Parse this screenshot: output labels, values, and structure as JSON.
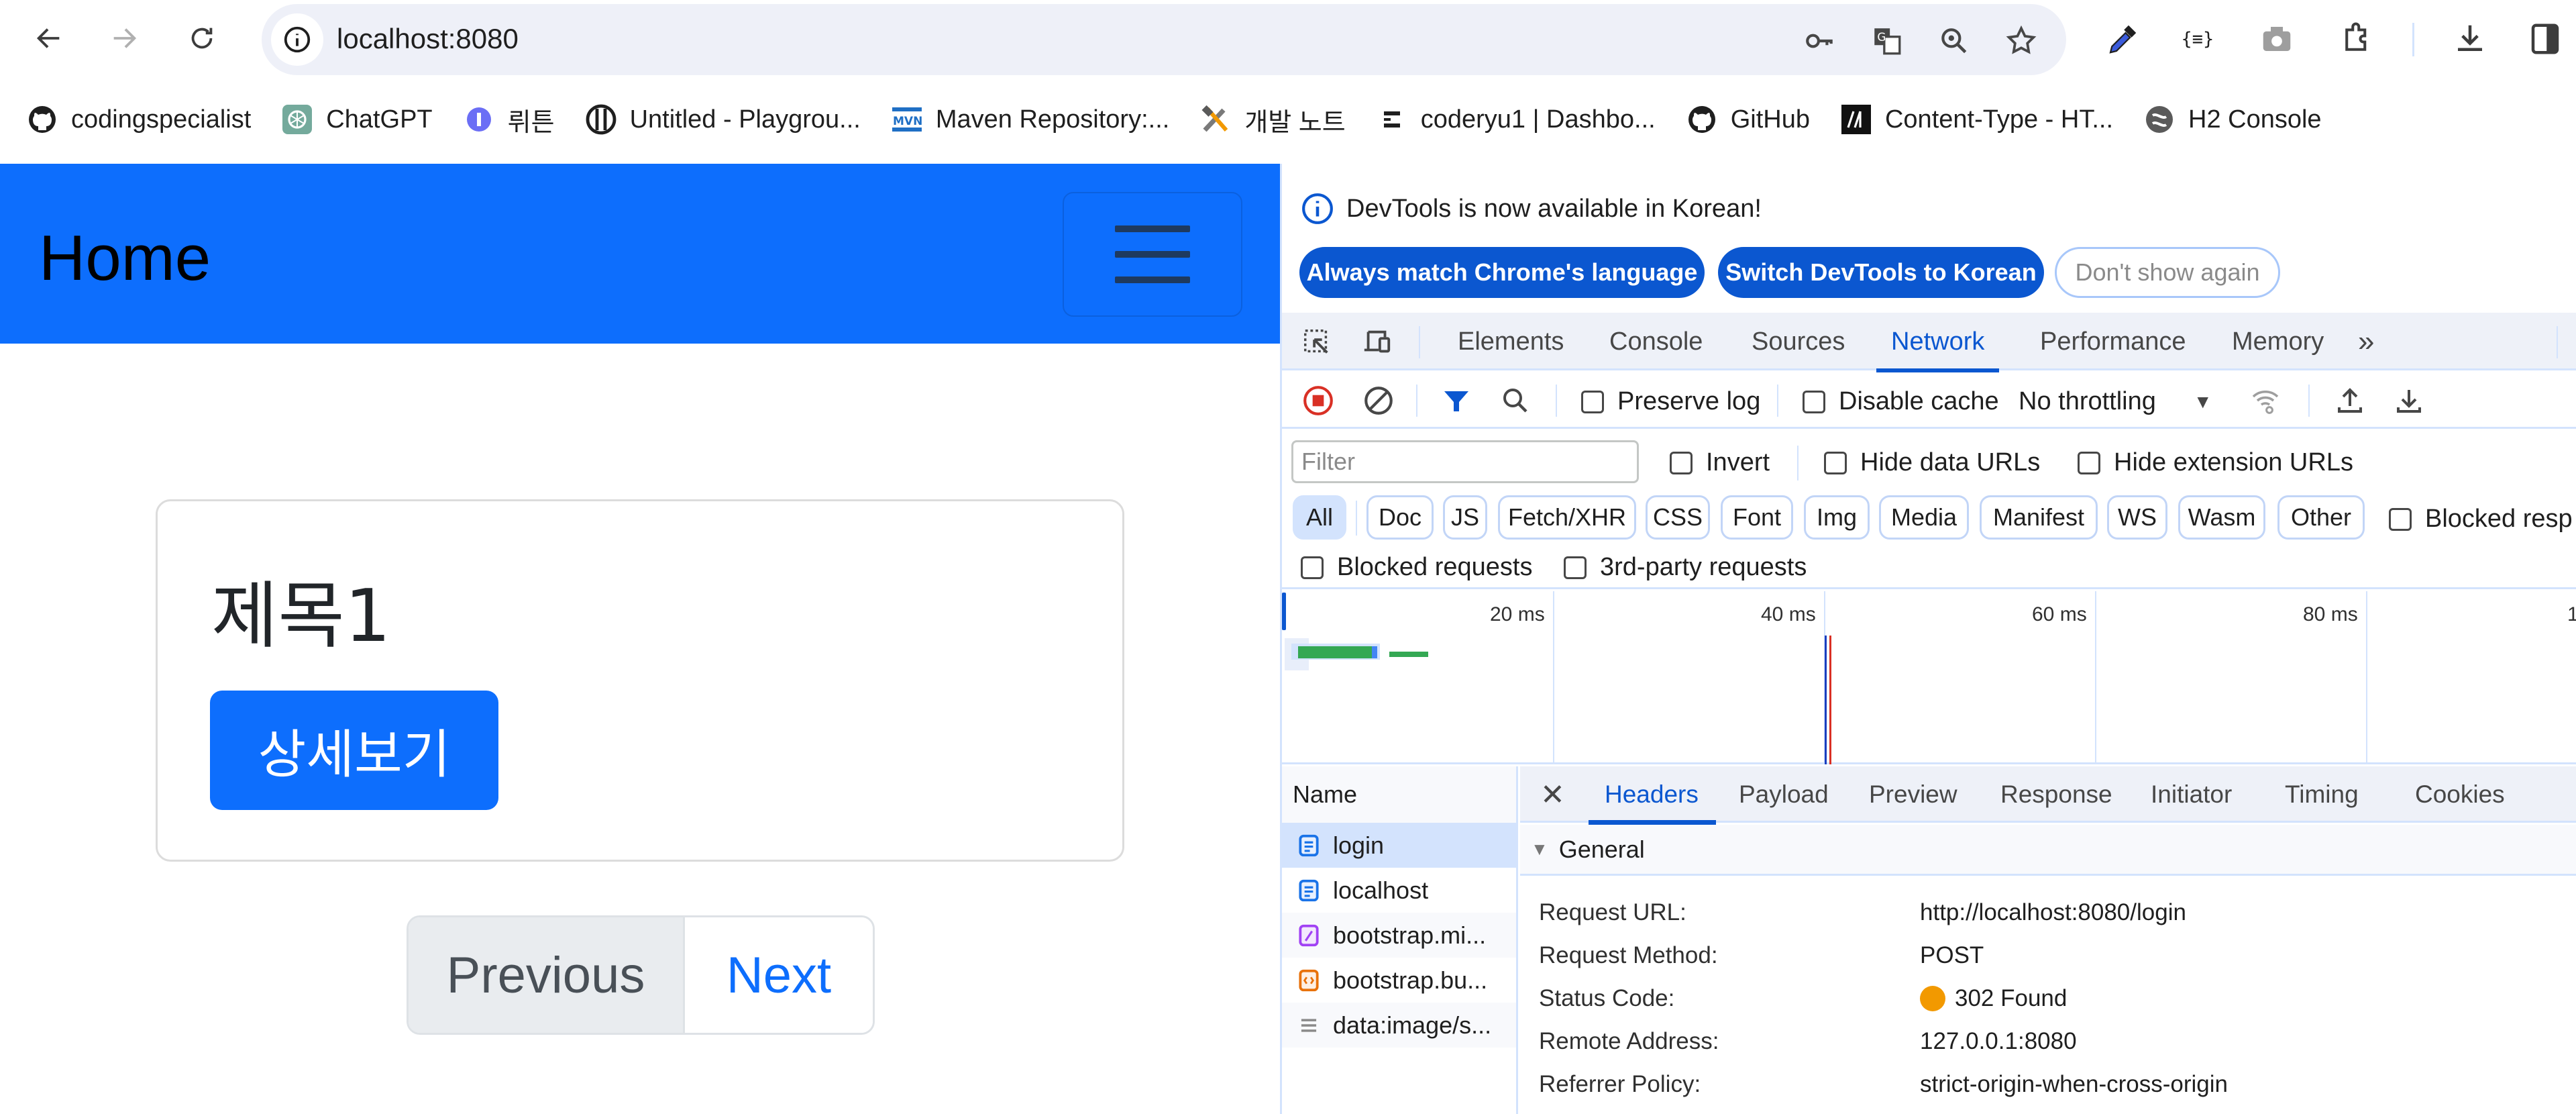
{
  "browser": {
    "url": "localhost:8080",
    "nav_icons": [
      "back-arrow-icon",
      "forward-arrow-icon",
      "reload-icon"
    ],
    "omnibox_icons": [
      "key-icon",
      "translate-icon",
      "zoom-icon",
      "bookmark-star-icon"
    ],
    "toolbar_icons": [
      "eyedropper-icon",
      "json-viewer-icon",
      "camera-icon",
      "extensions-puzzle-icon",
      "download-icon",
      "side-panel-icon"
    ]
  },
  "bookmarks": [
    {
      "label": "codingspecialist",
      "icon": "github-icon"
    },
    {
      "label": "ChatGPT",
      "icon": "chatgpt-icon"
    },
    {
      "label": "뤼튼",
      "icon": "wrtn-icon"
    },
    {
      "label": "Untitled - Playgrou...",
      "icon": "playground-icon"
    },
    {
      "label": "Maven Repository:...",
      "icon": "maven-icon"
    },
    {
      "label": "개발 노트",
      "icon": "tools-icon"
    },
    {
      "label": "coderyu1 | Dashbo...",
      "icon": "dashboard-icon"
    },
    {
      "label": "GitHub",
      "icon": "github-icon"
    },
    {
      "label": "Content-Type - HT...",
      "icon": "mdn-icon"
    },
    {
      "label": "H2 Console",
      "icon": "h2-icon"
    }
  ],
  "page": {
    "navbar_brand": "Home",
    "navbar_color": "#0d6efd",
    "card_title": "제목1",
    "detail_button": "상세보기",
    "pagination": {
      "previous": "Previous",
      "next": "Next"
    }
  },
  "devtools": {
    "infobar": {
      "message": "DevTools is now available in Korean!",
      "buttons": [
        "Always match Chrome's language",
        "Switch DevTools to Korean",
        "Don't show again"
      ]
    },
    "tabs": [
      "Elements",
      "Console",
      "Sources",
      "Network",
      "Performance",
      "Memory"
    ],
    "active_tab": "Network",
    "toolbar": {
      "preserve_log": "Preserve log",
      "disable_cache": "Disable cache",
      "throttling": "No throttling"
    },
    "filter": {
      "placeholder": "Filter",
      "invert": "Invert",
      "hide_data_urls": "Hide data URLs",
      "hide_extension_urls": "Hide extension URLs"
    },
    "type_chips": [
      "All",
      "Doc",
      "JS",
      "Fetch/XHR",
      "CSS",
      "Font",
      "Img",
      "Media",
      "Manifest",
      "WS",
      "Wasm",
      "Other"
    ],
    "active_chip": "All",
    "blocked_responses": "Blocked resp",
    "blocked_requests": "Blocked requests",
    "third_party": "3rd-party requests",
    "timeline": {
      "ticks": [
        "20 ms",
        "40 ms",
        "60 ms",
        "80 ms",
        "1"
      ],
      "dom_content_loaded_ms": 40.2,
      "load_ms": 40.6
    },
    "requests": {
      "header": "Name",
      "rows": [
        {
          "name": "login",
          "type": "document",
          "selected": true
        },
        {
          "name": "localhost",
          "type": "document"
        },
        {
          "name": "bootstrap.mi...",
          "type": "stylesheet"
        },
        {
          "name": "bootstrap.bu...",
          "type": "script"
        },
        {
          "name": "data:image/s...",
          "type": "other"
        }
      ]
    },
    "detail_tabs": [
      "Headers",
      "Payload",
      "Preview",
      "Response",
      "Initiator",
      "Timing",
      "Cookies"
    ],
    "active_detail_tab": "Headers",
    "general": {
      "title": "General",
      "rows": [
        {
          "key": "Request URL:",
          "value": "http://localhost:8080/login"
        },
        {
          "key": "Request Method:",
          "value": "POST"
        },
        {
          "key": "Status Code:",
          "value": "302 Found",
          "status_color": "#f29900"
        },
        {
          "key": "Remote Address:",
          "value": "127.0.0.1:8080"
        },
        {
          "key": "Referrer Policy:",
          "value": "strict-origin-when-cross-origin"
        }
      ]
    }
  }
}
